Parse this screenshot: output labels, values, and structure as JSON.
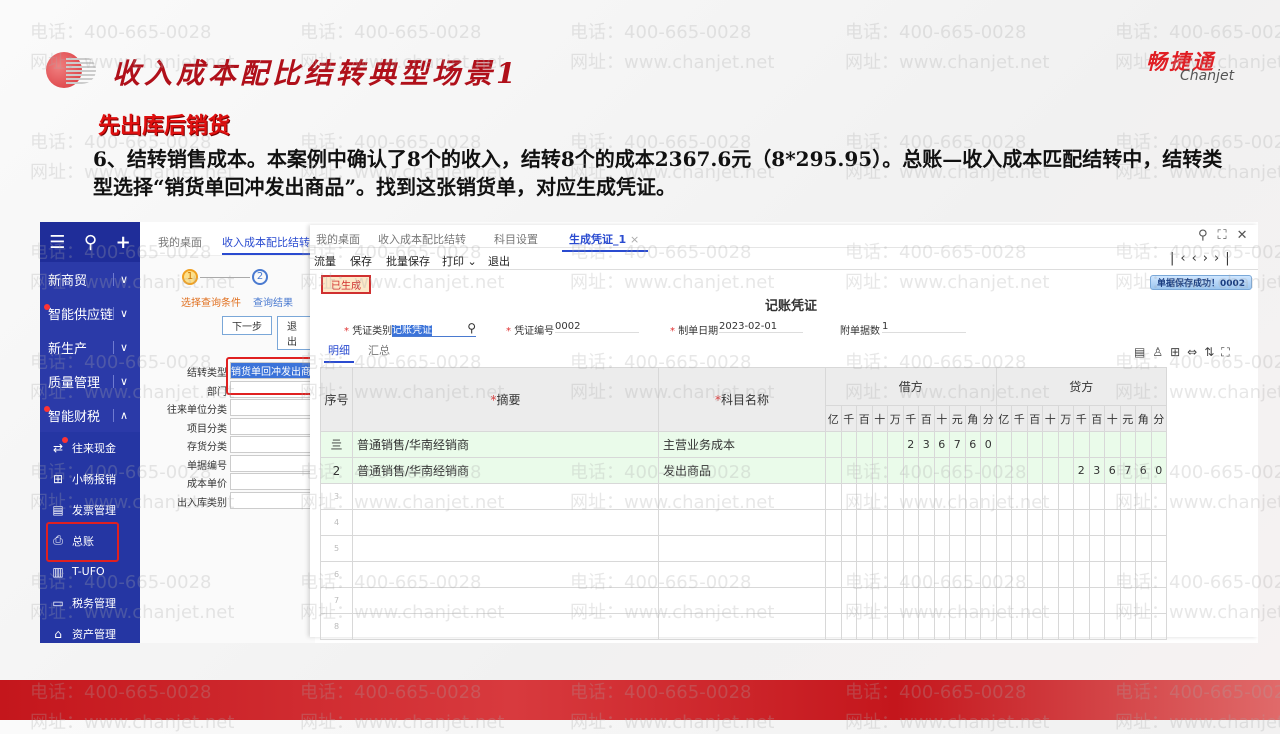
{
  "watermark": {
    "phone": "电话：400-665-0028",
    "site": "网址：www.chanjet.net"
  },
  "slide": {
    "title": "收入成本配比结转典型场景1",
    "brand_cn": "畅捷通",
    "brand_en": "Chanjet",
    "subtitle": "先出库后销货",
    "paragraph": "6、结转销售成本。本案例中确认了8个的收入，结转8个的成本2367.6元（8*295.95）。总账—收入成本匹配结转中，结转类型选择“销货单回冲发出商品”。找到这张销货单，对应生成凭证。"
  },
  "sidebar": {
    "top_icons": [
      "menu-icon",
      "search-icon",
      "plus-icon"
    ],
    "items": [
      {
        "label": "新商贸",
        "dot": false,
        "chev": "∨"
      },
      {
        "label": "智能供应链",
        "dot": true,
        "chev": "∨"
      },
      {
        "label": "新生产",
        "dot": false,
        "chev": "∨"
      },
      {
        "label": "质量管理",
        "dot": false,
        "chev": "∨"
      },
      {
        "label": "智能财税",
        "dot": true,
        "chev": "∧"
      }
    ],
    "subitems": [
      {
        "label": "往来现金",
        "icon": "⇄"
      },
      {
        "label": "小畅报销",
        "icon": "⊞"
      },
      {
        "label": "发票管理",
        "icon": "▤"
      },
      {
        "label": "总账",
        "icon": "⎙"
      },
      {
        "label": "T-UFO",
        "icon": "▥"
      },
      {
        "label": "税务管理",
        "icon": "▭"
      },
      {
        "label": "资产管理",
        "icon": "⌂"
      }
    ]
  },
  "back": {
    "tabs": [
      "我的桌面",
      "收入成本配比结转"
    ],
    "step1": "选择查询条件",
    "step2": "查询结果",
    "next": "下一步",
    "exit": "退出",
    "fields": [
      {
        "label": "结转类型",
        "value": "销货单回冲发出商品"
      },
      {
        "label": "部门",
        "value": ""
      },
      {
        "label": "往来单位分类",
        "value": ""
      },
      {
        "label": "项目分类",
        "value": ""
      },
      {
        "label": "存货分类",
        "value": ""
      },
      {
        "label": "单据编号",
        "value": ""
      },
      {
        "label": "成本单价",
        "value": ""
      },
      {
        "label": "出入库类别",
        "value": ""
      }
    ]
  },
  "front": {
    "tabs": [
      "我的桌面",
      "收入成本配比结转",
      "科目设置",
      "生成凭证_1"
    ],
    "toolbar": [
      "流量",
      "保存",
      "批量保存",
      "打印 ⌄",
      "退出"
    ],
    "status": "已生成",
    "doc_title": "记账凭证",
    "toast": "单据保存成功！0002",
    "voucher_type_label": "凭证类别",
    "voucher_type": "记账凭证",
    "voucher_no_label": "凭证编号",
    "voucher_no": "0002",
    "date_label": "制单日期",
    "date": "2023-02-01",
    "attach_label": "附单据数",
    "attach": "1",
    "subtabs": [
      "明细",
      "汇总"
    ],
    "headers": {
      "seq": "序号",
      "summary": "摘要",
      "account": "科目名称",
      "debit": "借方",
      "credit": "贷方",
      "digits": [
        "亿",
        "千",
        "百",
        "十",
        "万",
        "千",
        "百",
        "十",
        "元",
        "角",
        "分"
      ]
    },
    "rows": [
      {
        "seq": "亖",
        "summary": "普通销售/华南经销商",
        "account": "主营业务成本",
        "debit": "236760",
        "credit": ""
      },
      {
        "seq": "2",
        "summary": "普通销售/华南经销商",
        "account": "发出商品",
        "debit": "",
        "credit": "236760"
      },
      {
        "seq": "3"
      },
      {
        "seq": "4"
      },
      {
        "seq": "5"
      },
      {
        "seq": "6"
      },
      {
        "seq": "7"
      },
      {
        "seq": "8"
      }
    ]
  }
}
